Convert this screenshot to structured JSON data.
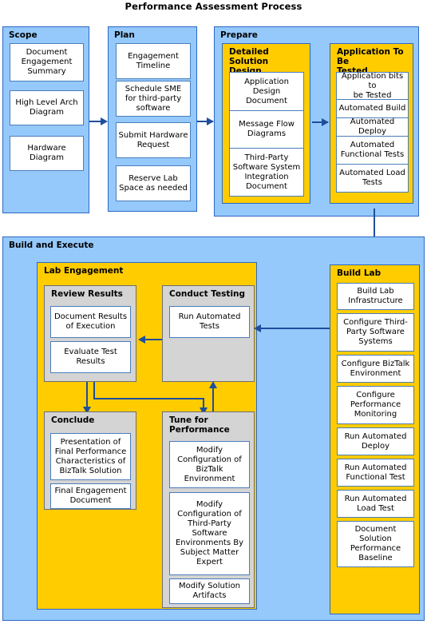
{
  "title": "Performance Assessment Process",
  "colors": {
    "phase_blue": "#95C9FC",
    "subgroup_orange": "#FFCC00",
    "subgroup_gray": "#D4D4D4",
    "leaf_white": "#FFFFFF",
    "leaf_border": "#4A7EBB",
    "group_border": "#2C68C4",
    "connector": "#1F4E9C",
    "text": "#000000"
  },
  "phases": {
    "scope": {
      "label": "Scope",
      "items": [
        "Document\nEngagement\nSummary",
        "High Level Arch\nDiagram",
        "Hardware\nDiagram"
      ]
    },
    "plan": {
      "label": "Plan",
      "items": [
        "Engagement\nTimeline",
        "Schedule SME\nfor third-party\nsoftware",
        "Submit Hardware\nRequest",
        "Reserve Lab\nSpace as needed"
      ]
    },
    "prepare": {
      "label": "Prepare",
      "groups": {
        "detailed_solution_design": {
          "label": "Detailed Solution\nDesign",
          "items": [
            "Application\nDesign\nDocument",
            "Message Flow\nDiagrams",
            "Third-Party\nSoftware System\nIntegration\nDocument"
          ]
        },
        "application_to_be_tested": {
          "label": "Application To Be\nTested",
          "items": [
            "Application bits to\nbe Tested",
            "Automated Build",
            "Automated Deploy",
            "Automated\nFunctional  Tests",
            "Automated Load\nTests"
          ]
        }
      }
    },
    "build_and_execute": {
      "label": "Build and Execute",
      "lab_engagement": {
        "label": "Lab Engagement",
        "groups": {
          "review_results": {
            "label": "Review Results",
            "items": [
              "Document Results\nof Execution",
              "Evaluate Test\nResults"
            ]
          },
          "conduct_testing": {
            "label": "Conduct Testing",
            "items": [
              "Run Automated\nTests"
            ]
          },
          "conclude": {
            "label": "Conclude",
            "items": [
              "Presentation of\nFinal Performance\nCharacteristics of\nBizTalk Solution",
              "Final Engagement\nDocument"
            ]
          },
          "tune_for_performance": {
            "label": "Tune for\nPerformance",
            "items": [
              "Modify\nConfiguration of\nBizTalk\nEnvironment",
              "Modify\nConfiguration of\nThird-Party\nSoftware\nEnvironments By\nSubject Matter\nExpert",
              "Modify Solution\nArtifacts"
            ]
          }
        }
      },
      "build_lab": {
        "label": "Build Lab",
        "items": [
          "Build Lab\nInfrastructure",
          "Configure Third-\nParty Software\nSystems",
          "Configure BizTalk\nEnvironment",
          "Configure\nPerformance\nMonitoring",
          "Run Automated\nDeploy",
          "Run Automated\nFunctional Test",
          "Run Automated\nLoad Test",
          "Document\nSolution\nPerformance\nBaseline"
        ]
      }
    }
  },
  "connectors": [
    {
      "name": "scope-to-plan",
      "from": "Scope",
      "to": "Plan",
      "direction": "right"
    },
    {
      "name": "plan-to-prepare",
      "from": "Plan",
      "to": "Prepare",
      "direction": "right"
    },
    {
      "name": "design-to-application",
      "from": "Detailed Solution Design",
      "to": "Application To Be Tested",
      "direction": "right"
    },
    {
      "name": "prepare-to-build-lab",
      "from": "Application To Be Tested",
      "to": "Build Lab",
      "direction": "down"
    },
    {
      "name": "build-lab-to-conduct-testing",
      "from": "Build Lab",
      "to": "Conduct Testing",
      "direction": "left"
    },
    {
      "name": "conduct-testing-to-review-results",
      "from": "Conduct Testing",
      "to": "Review Results",
      "direction": "left"
    },
    {
      "name": "review-results-to-conclude",
      "from": "Review Results",
      "to": "Conclude",
      "direction": "down"
    },
    {
      "name": "review-results-to-tune",
      "from": "Review Results",
      "to": "Tune for Performance",
      "direction": "down"
    },
    {
      "name": "tune-to-conduct-testing",
      "from": "Tune for Performance",
      "to": "Conduct Testing",
      "direction": "up"
    }
  ]
}
